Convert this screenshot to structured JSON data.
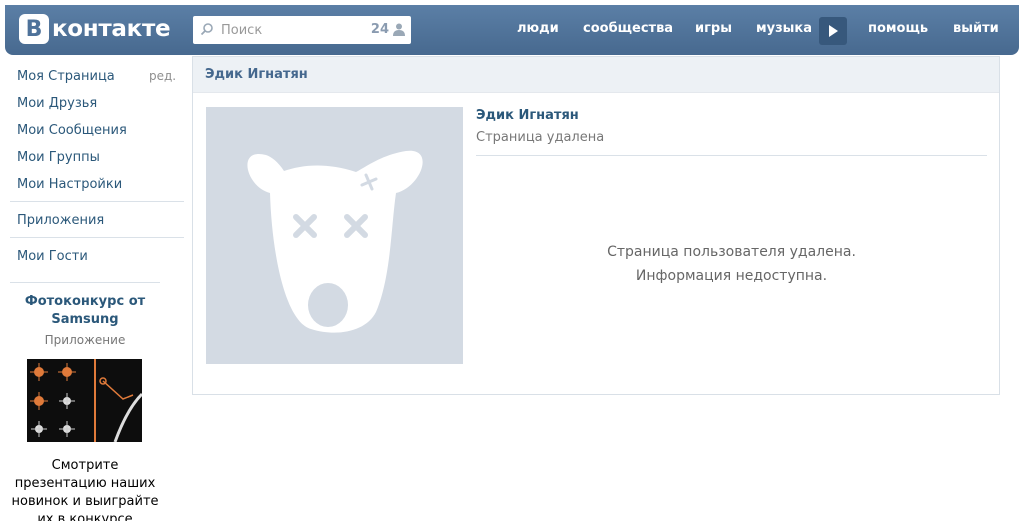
{
  "header": {
    "logo_letter": "В",
    "logo_text": "контакте",
    "search": {
      "placeholder": "Поиск",
      "count": "24"
    },
    "nav": {
      "people": "люди",
      "communities": "сообщества",
      "games": "игры",
      "music": "музыка",
      "help": "помощь",
      "logout": "выйти"
    }
  },
  "sidebar": {
    "items": [
      {
        "label": "Моя Страница"
      },
      {
        "label": "Мои Друзья"
      },
      {
        "label": "Мои Сообщения"
      },
      {
        "label": "Мои Группы"
      },
      {
        "label": "Мои Настройки"
      },
      {
        "label": "Приложения"
      },
      {
        "label": "Мои Гости"
      }
    ],
    "edit_label": "ред.",
    "promo": {
      "title": "Фотоконкурс от Samsung",
      "subtitle": "Приложение",
      "text": "Смотрите презентацию наших новинок и выиграйте их в конкурсе"
    }
  },
  "main": {
    "header_title": "Эдик Игнатян",
    "profile_name": "Эдик Игнатян",
    "profile_status": "Страница удалена",
    "message_line1": "Страница пользователя удалена.",
    "message_line2": "Информация недоступна."
  },
  "colors": {
    "header_bg": "#4e729a",
    "link": "#2b587a",
    "avatar_bg": "#d3dae3"
  }
}
